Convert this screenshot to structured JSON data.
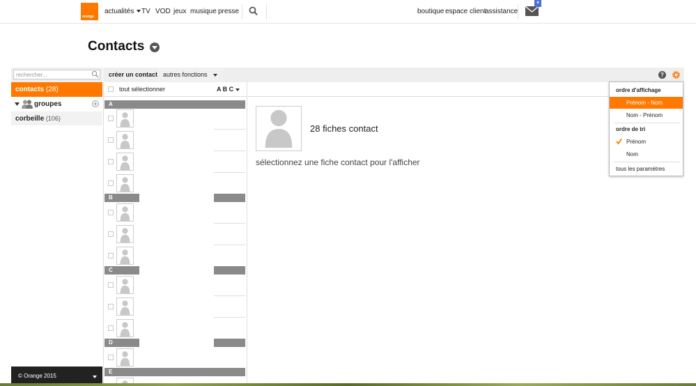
{
  "brand": {
    "logo_text": "orange",
    "accent": "#ff7900"
  },
  "topnav": {
    "items": [
      "actualités",
      "TV",
      "VOD",
      "jeux",
      "musique",
      "presse"
    ],
    "right_items": [
      "boutique",
      "espace client",
      "assistance"
    ],
    "mail_badge": "*"
  },
  "page": {
    "title": "Contacts"
  },
  "sidebar": {
    "search_placeholder": "rechercher...",
    "contacts_label": "contacts",
    "contacts_count": "(28)",
    "groups_label": "groupes",
    "trash_label": "corbeille",
    "trash_count": "(106)",
    "footer": "© Orange 2015"
  },
  "toolbar": {
    "create_label": "créer un contact",
    "more_label": "autres fonctions"
  },
  "list": {
    "select_all": "tout sélectionner",
    "sort_label": "A B C",
    "letters": [
      "A",
      "B",
      "C",
      "D",
      "E"
    ]
  },
  "detail": {
    "count_text": "28 fiches contact",
    "hint": "sélectionnez une fiche contact pour l'afficher"
  },
  "dropdown": {
    "display_order_title": "ordre d'affichage",
    "display_options": [
      "Prénom - Nom",
      "Nom - Prénom"
    ],
    "display_selected": "Prénom - Nom",
    "sort_order_title": "ordre de tri",
    "sort_options": [
      "Prénom",
      "Nom"
    ],
    "sort_selected": "Prénom",
    "all_settings": "tous les paramètres"
  },
  "icons": {
    "search": "search-icon",
    "mail": "mail-icon",
    "help": "help-icon",
    "gear": "gear-icon",
    "help_glyph": "?"
  }
}
